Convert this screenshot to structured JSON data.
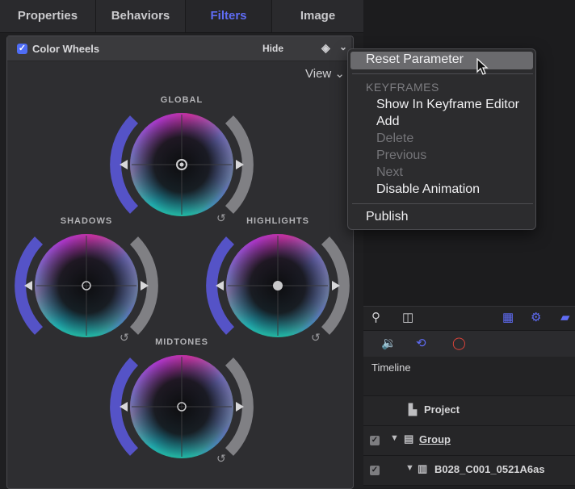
{
  "tabs": [
    {
      "label": "Properties"
    },
    {
      "label": "Behaviors"
    },
    {
      "label": "Filters"
    },
    {
      "label": "Image"
    }
  ],
  "active_tab": "Filters",
  "filter_row": {
    "title": "Color Wheels",
    "hide_label": "Hide",
    "enabled": true
  },
  "view_menu": {
    "label": "View ⌄"
  },
  "wheels": {
    "global": "GLOBAL",
    "shadows": "SHADOWS",
    "highlights": "HIGHLIGHTS",
    "midtones": "MIDTONES"
  },
  "context_menu": {
    "reset": "Reset Parameter",
    "keyframes_header": "KEYFRAMES",
    "show_in_editor": "Show In Keyframe Editor",
    "add": "Add",
    "delete": "Delete",
    "previous": "Previous",
    "next": "Next",
    "disable_animation": "Disable Animation",
    "publish": "Publish"
  },
  "timeline": {
    "title": "Timeline",
    "rows": [
      {
        "label": "Project"
      },
      {
        "label": "Group"
      },
      {
        "label": "B028_C001_0521A6as"
      }
    ]
  },
  "colors": {
    "accent": "#5f6cf5",
    "checkbox": "#4f6df5",
    "record": "#e0443a"
  },
  "icons": [
    "search-icon",
    "layout-icon",
    "checkerboard-icon",
    "gear-icon",
    "layers-icon",
    "audio-icon",
    "loop-icon",
    "record-icon",
    "keyframe-diamond-icon",
    "reset-arrow-icon",
    "document-icon",
    "group-icon",
    "film-icon",
    "cursor-icon"
  ]
}
